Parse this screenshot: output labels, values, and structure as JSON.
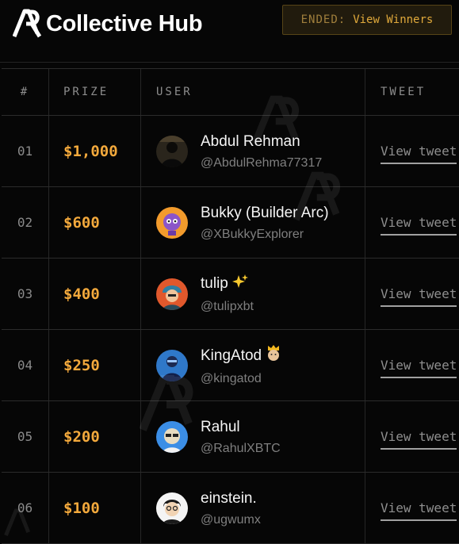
{
  "brand": {
    "name": "Collective Hub",
    "logo_icon": "ar-logo-icon"
  },
  "status": {
    "prefix": "ENDED:",
    "link_label": "View Winners"
  },
  "table": {
    "headers": {
      "rank": "#",
      "prize": "PRIZE",
      "user": "USER",
      "tweet": "TWEET"
    },
    "rows": [
      {
        "rank": "01",
        "prize": "$1,000",
        "name": "Abdul Rehman",
        "handle": "@AbdulRehma77317",
        "tweet_label": "View tweet",
        "emoji": ""
      },
      {
        "rank": "02",
        "prize": "$600",
        "name": "Bukky (Builder Arc)",
        "handle": "@XBukkyExplorer",
        "tweet_label": "View tweet",
        "emoji": ""
      },
      {
        "rank": "03",
        "prize": "$400",
        "name": "tulip",
        "handle": "@tulipxbt",
        "tweet_label": "View tweet",
        "emoji": "sparkles-icon"
      },
      {
        "rank": "04",
        "prize": "$250",
        "name": "KingAtod",
        "handle": "@kingatod",
        "tweet_label": "View tweet",
        "emoji": "crowned-face-icon"
      },
      {
        "rank": "05",
        "prize": "$200",
        "name": "Rahul",
        "handle": "@RahulXBTC",
        "tweet_label": "View tweet",
        "emoji": ""
      },
      {
        "rank": "06",
        "prize": "$100",
        "name": "einstein.",
        "handle": "@ugwumx",
        "tweet_label": "View tweet",
        "emoji": ""
      }
    ]
  },
  "colors": {
    "background": "#060606",
    "accent": "#f3a93c",
    "border": "#2b2b2b",
    "muted": "#8a8a8a"
  }
}
